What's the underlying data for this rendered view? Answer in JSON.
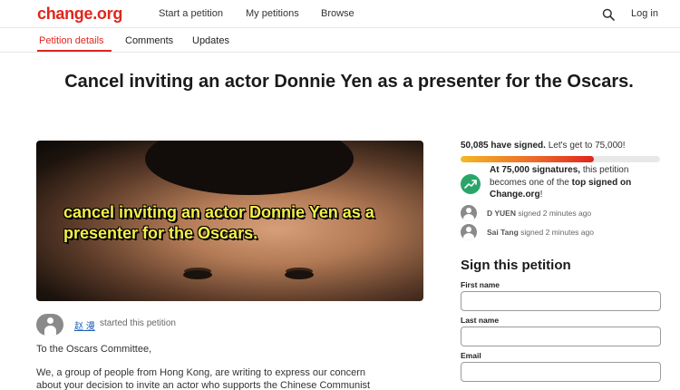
{
  "header": {
    "logo": "change.org",
    "nav": [
      "Start a petition",
      "My petitions",
      "Browse"
    ],
    "login": "Log in"
  },
  "tabs": [
    "Petition details",
    "Comments",
    "Updates"
  ],
  "petition": {
    "title": "Cancel inviting an actor Donnie Yen as a presenter for the Oscars.",
    "image_caption": "cancel inviting an actor Donnie Yen as a presenter for the Oscars.",
    "starter_name": "赵 漫",
    "starter_text": "started this petition",
    "salutation": "To the Oscars Committee,",
    "body_line1": "We, a group of people from Hong Kong, are writing to express our concern",
    "body_line2": "about your decision to invite an actor who supports the Chinese Communist"
  },
  "sidebar": {
    "signed_count": "50,085 have signed.",
    "goal_text": "Let's get to 75,000!",
    "progress": 0.668,
    "milestone_prefix": "At 75,000 signatures,",
    "milestone_mid": "this petition becomes one of the",
    "milestone_bold": "top signed on Change.org",
    "milestone_suffix": "!",
    "recent_signers": [
      {
        "name": "D YUEN",
        "time": "signed 2 minutes ago"
      },
      {
        "name": "Sai Tang",
        "time": "signed 2 minutes ago"
      }
    ]
  },
  "form": {
    "title": "Sign this petition",
    "first_name_label": "First name",
    "last_name_label": "Last name",
    "email_label": "Email"
  },
  "colors": {
    "brand": "#e1251b",
    "success": "#2aa568",
    "link": "#1a5fb4"
  }
}
